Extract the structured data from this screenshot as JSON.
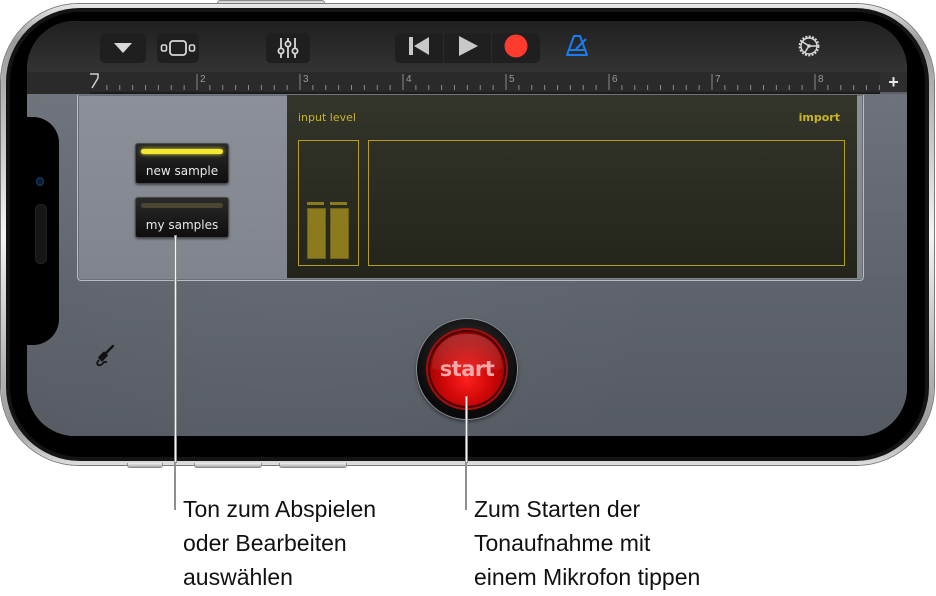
{
  "toolbar": {
    "items": [
      {
        "name": "dropdown-button",
        "icon": "triangle-down-icon"
      },
      {
        "name": "view-toggle-button",
        "icon": "track-view-icon"
      },
      {
        "name": "mixer-button",
        "icon": "sliders-icon"
      },
      {
        "name": "rewind-button",
        "icon": "skip-back-icon"
      },
      {
        "name": "play-button",
        "icon": "play-icon"
      },
      {
        "name": "record-button",
        "icon": "record-icon"
      },
      {
        "name": "metronome-button",
        "icon": "metronome-icon"
      },
      {
        "name": "settings-button",
        "icon": "gear-icon"
      }
    ],
    "colors": {
      "record": "#ff3b30",
      "metronome": "#1a7cf5",
      "icon": "#d8d8d8"
    }
  },
  "ruler": {
    "bar_numbers": [
      "2",
      "3",
      "4",
      "5",
      "6",
      "7",
      "8"
    ],
    "add_label": "+"
  },
  "sampler": {
    "new_sample_label": "new sample",
    "my_samples_label": "my samples",
    "new_sample_led_on": true,
    "input_level_label": "input level",
    "import_label": "import",
    "input_level_channels": [
      0.45,
      0.45
    ],
    "display_color": "#c9b526",
    "start_label": "start"
  },
  "callouts": {
    "left": [
      "Ton zum Abspielen",
      "oder Bearbeiten",
      "auswählen"
    ],
    "right": [
      "Zum Starten der",
      "Tonaufnahme mit",
      "einem Mikrofon tippen"
    ]
  }
}
